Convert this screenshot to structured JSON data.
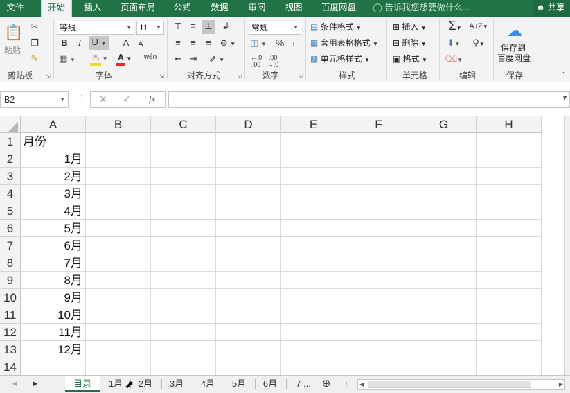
{
  "ribbon_tabs": [
    "文件",
    "开始",
    "插入",
    "页面布局",
    "公式",
    "数据",
    "审阅",
    "视图",
    "百度网盘"
  ],
  "active_tab": "开始",
  "tell_me": "告诉我您想要做什么...",
  "share": "共享",
  "clipboard": {
    "paste": "粘贴",
    "label": "剪贴板"
  },
  "font": {
    "name": "等线",
    "size": "11",
    "bold": "B",
    "italic": "I",
    "underline": "U",
    "grow": "A",
    "shrink": "A",
    "fill_color": "#f6d62f",
    "font_color": "#e62a2a",
    "label": "字体"
  },
  "alignment": {
    "label": "对齐方式"
  },
  "number": {
    "format": "常规",
    "percent": "%",
    "comma": ",",
    "label": "数字"
  },
  "styles": {
    "conditional": "条件格式",
    "table": "套用表格格式",
    "cell": "单元格样式",
    "label": "样式"
  },
  "cells": {
    "insert": "插入",
    "delete": "删除",
    "format": "格式",
    "label": "单元格"
  },
  "editing": {
    "label": "编辑"
  },
  "save": {
    "line1": "保存到",
    "line2": "百度网盘",
    "label": "保存"
  },
  "name_box": "B2",
  "fx": "fx",
  "columns": [
    "A",
    "B",
    "C",
    "D",
    "E",
    "F",
    "G",
    "H"
  ],
  "rows": [
    "1",
    "2",
    "3",
    "4",
    "5",
    "6",
    "7",
    "8",
    "9",
    "10",
    "11",
    "12",
    "13",
    "14"
  ],
  "cell_a1": "月份",
  "months": [
    "1月",
    "2月",
    "3月",
    "4月",
    "5月",
    "6月",
    "7月",
    "8月",
    "9月",
    "10月",
    "11月",
    "12月"
  ],
  "sheet_tabs": [
    "目录",
    "1月",
    "2月",
    "3月",
    "4月",
    "5月",
    "6月",
    "7 ..."
  ],
  "active_sheet": "目录",
  "accent": "#217346"
}
